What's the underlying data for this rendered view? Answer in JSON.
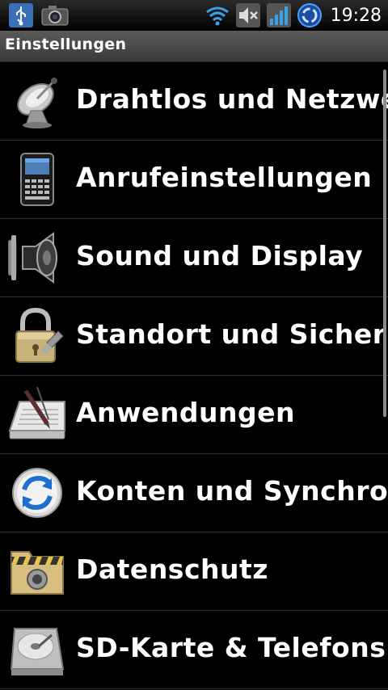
{
  "status_bar": {
    "time": "19:28",
    "left_icons": [
      "usb-icon",
      "camera-icon"
    ],
    "right_icons": [
      "wifi-icon",
      "volume-muted-icon",
      "signal-icon",
      "sync-icon"
    ]
  },
  "title_bar": {
    "title": "Einstellungen"
  },
  "settings_list": {
    "items": [
      {
        "label": "Drahtlos und Netzwe",
        "icon": "satellite-dish-icon"
      },
      {
        "label": "Anrufeinstellungen",
        "icon": "phone-icon"
      },
      {
        "label": "Sound und Display",
        "icon": "speaker-icon"
      },
      {
        "label": "Standort und Sicherh",
        "icon": "padlock-icon"
      },
      {
        "label": "Anwendungen",
        "icon": "pen-document-icon"
      },
      {
        "label": "Konten und Synchro",
        "icon": "sync-arrows-icon"
      },
      {
        "label": "Datenschutz",
        "icon": "safe-folder-icon"
      },
      {
        "label": "SD-Karte & Telefons",
        "icon": "hard-drive-icon"
      }
    ]
  }
}
